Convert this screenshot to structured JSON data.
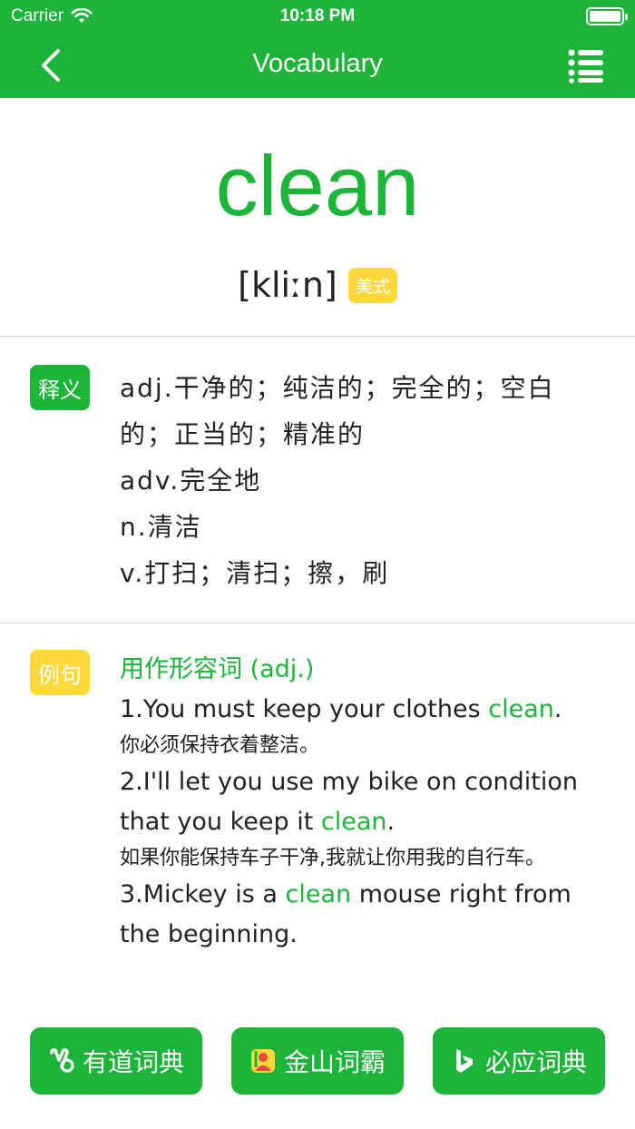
{
  "status_bar": {
    "carrier": "Carrier",
    "time": "10:18 PM"
  },
  "navbar": {
    "title": "Vocabulary",
    "back_icon": "chevron-left-icon",
    "menu_icon": "list-icon"
  },
  "word": {
    "text": "clean",
    "phonetic": "[kliːn]",
    "accent": "美式"
  },
  "definitions": {
    "tag": "释义",
    "lines": [
      "adj.干净的；纯洁的；完全的；空白",
      "的；正当的；精准的",
      "adv.完全地",
      "n.清洁",
      "v.打扫；清扫；擦，刷"
    ]
  },
  "examples": {
    "tag": "例句",
    "heading": "用作形容词 (adj.)",
    "items": [
      {
        "en_lines": [
          {
            "pre": "1.You must keep your clothes ",
            "hl": "clean",
            "post": "."
          }
        ],
        "zh": "你必须保持衣着整洁。"
      },
      {
        "en_lines": [
          {
            "pre": "2.I'll let you use my bike on condition",
            "hl": "",
            "post": ""
          },
          {
            "pre": "that you keep it ",
            "hl": "clean",
            "post": "."
          }
        ],
        "zh": "如果你能保持车子干净,我就让你用我的自行车。"
      },
      {
        "en_lines": [
          {
            "pre": "3.Mickey is a ",
            "hl": "clean",
            "post": " mouse right from"
          },
          {
            "pre": "the beginning.",
            "hl": "",
            "post": ""
          }
        ],
        "zh": ""
      }
    ]
  },
  "dictionaries": [
    {
      "label": "有道词典",
      "icon": "youdao-icon"
    },
    {
      "label": "金山词霸",
      "icon": "iciba-icon"
    },
    {
      "label": "必应词典",
      "icon": "bing-icon"
    }
  ],
  "colors": {
    "accent": "#1DB43A",
    "badge": "#FFD93B"
  }
}
